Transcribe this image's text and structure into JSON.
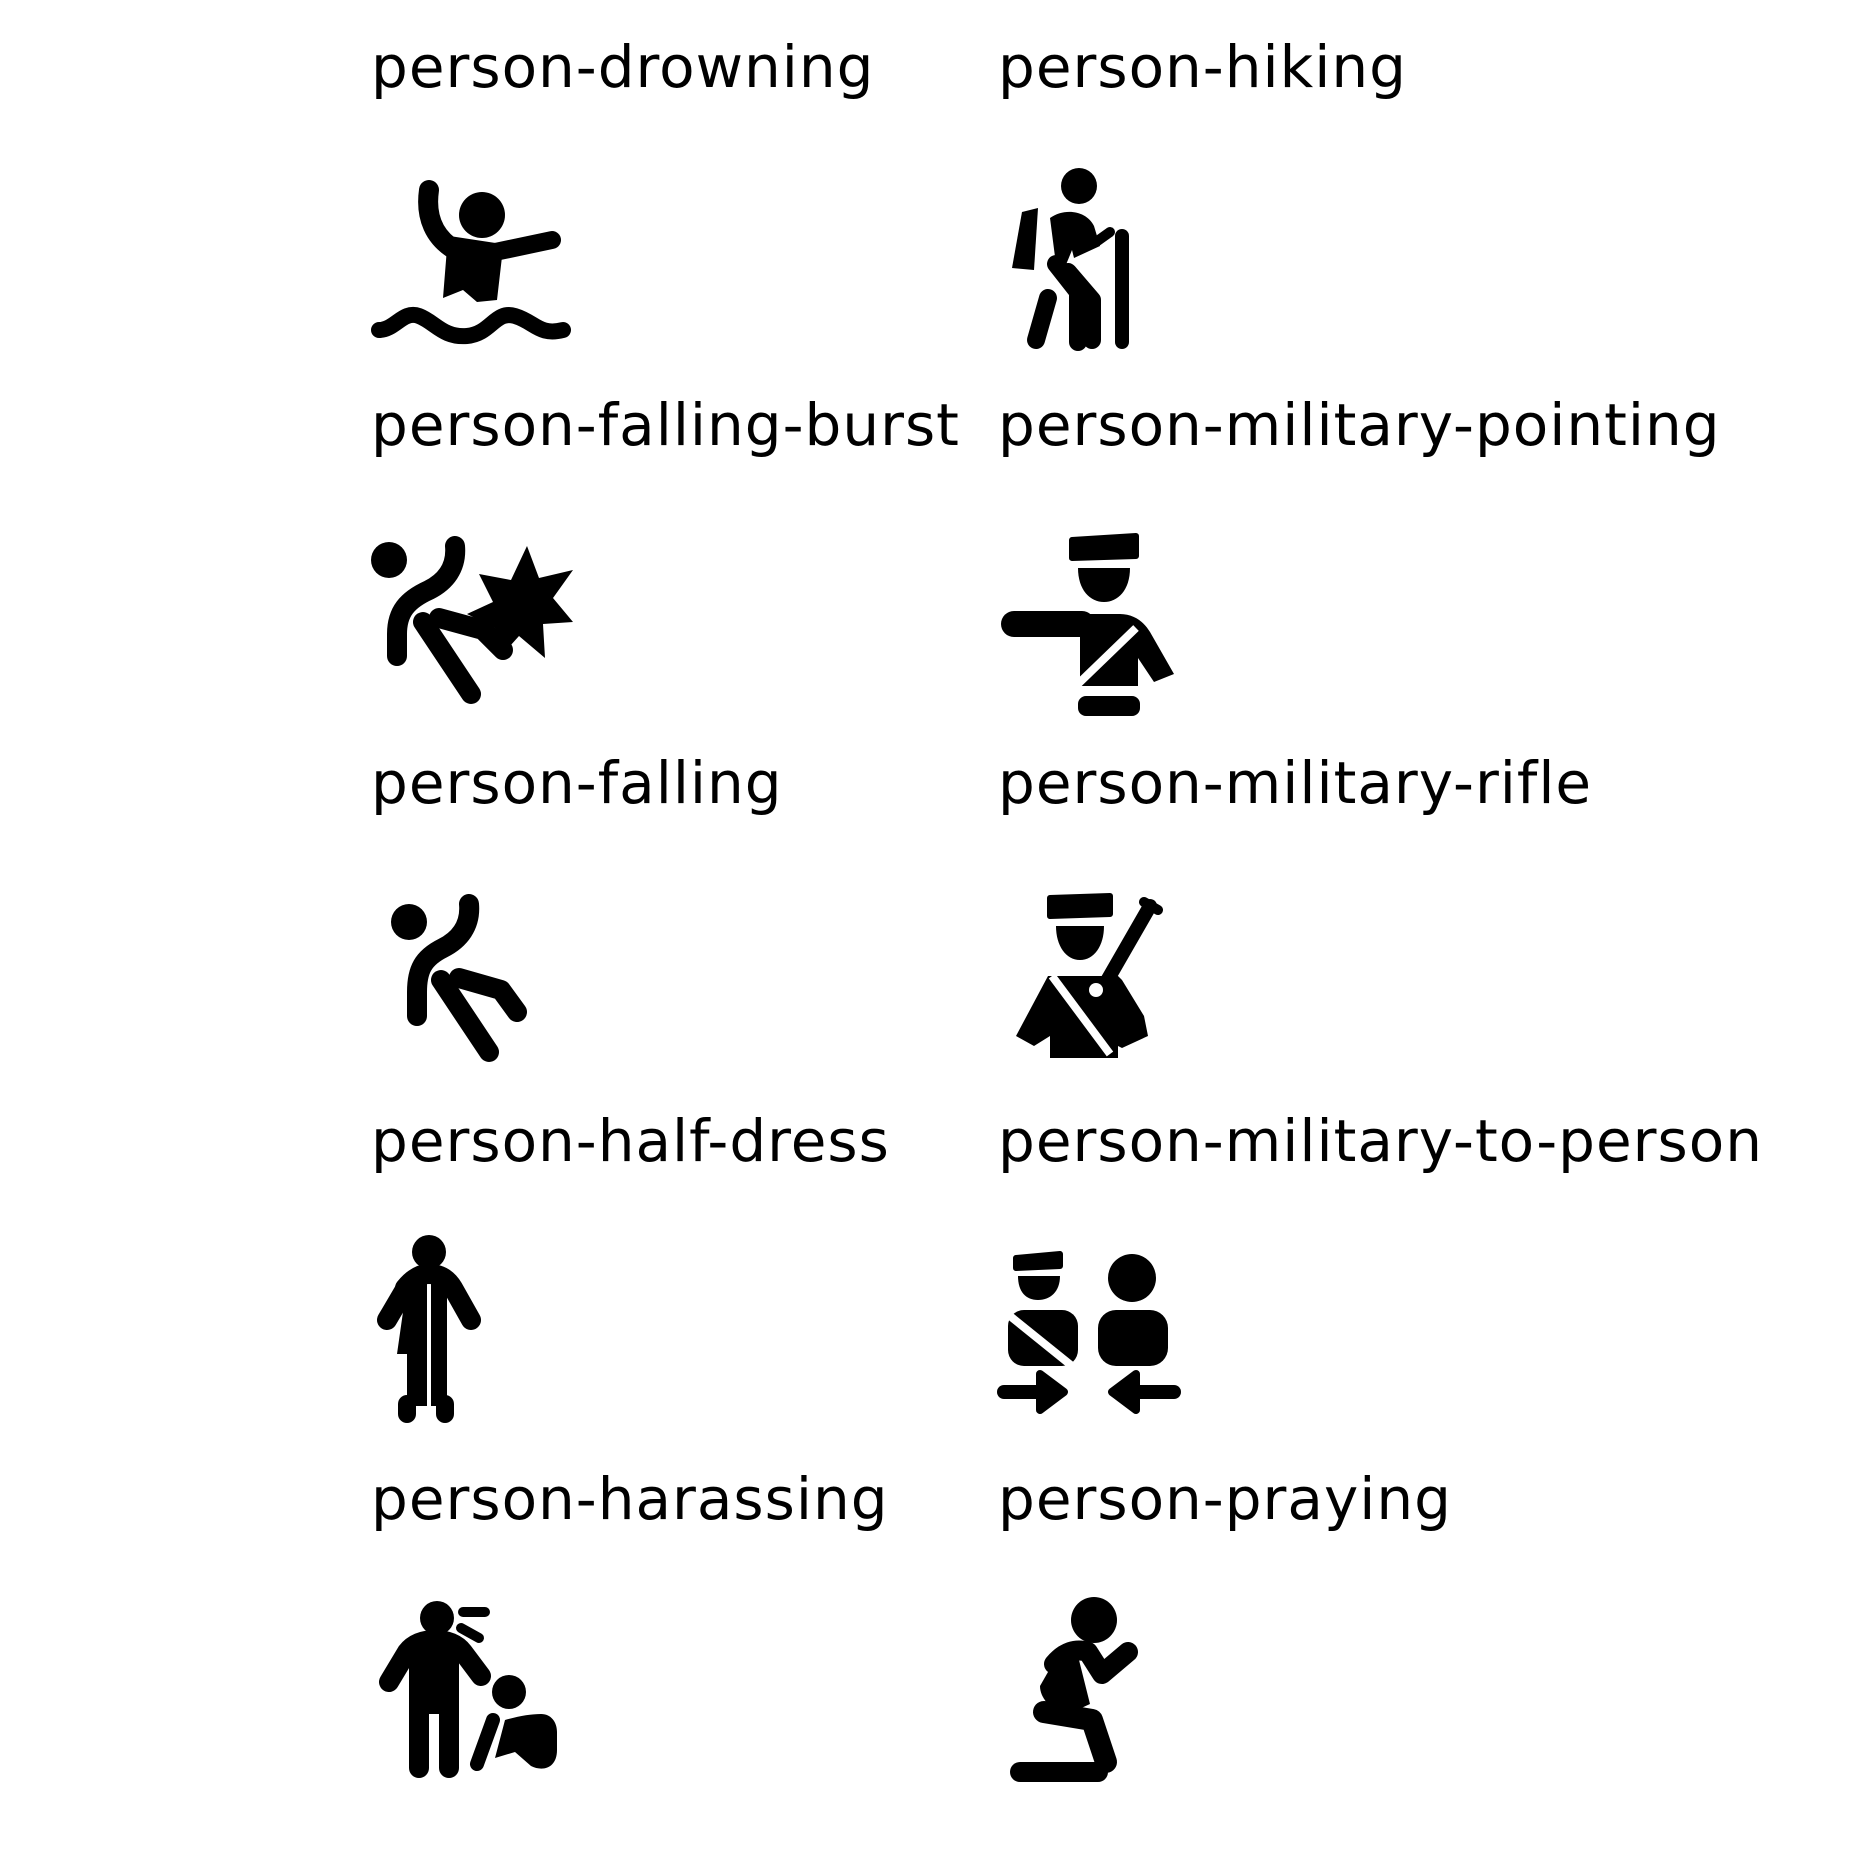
{
  "colors": {
    "background": "#ffffff",
    "foreground": "#000000"
  },
  "icons": [
    {
      "label": "person-drowning",
      "icon": "person-drowning-icon"
    },
    {
      "label": "person-hiking",
      "icon": "person-hiking-icon"
    },
    {
      "label": "person-falling-burst",
      "icon": "person-falling-burst-icon"
    },
    {
      "label": "person-military-pointing",
      "icon": "person-military-pointing-icon"
    },
    {
      "label": "person-falling",
      "icon": "person-falling-icon"
    },
    {
      "label": "person-military-rifle",
      "icon": "person-military-rifle-icon"
    },
    {
      "label": "person-half-dress",
      "icon": "person-half-dress-icon"
    },
    {
      "label": "person-military-to-person",
      "icon": "person-military-to-person-icon"
    },
    {
      "label": "person-harassing",
      "icon": "person-harassing-icon"
    },
    {
      "label": "person-praying",
      "icon": "person-praying-icon"
    }
  ]
}
